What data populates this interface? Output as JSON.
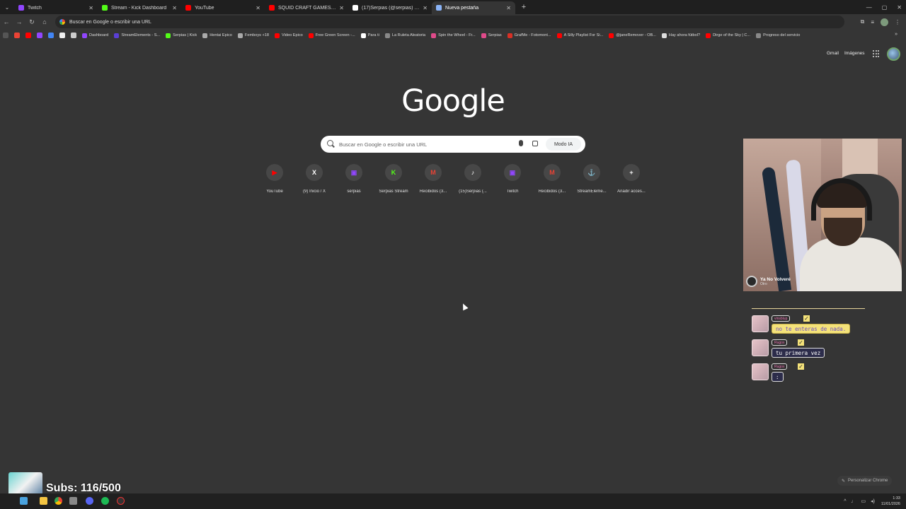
{
  "tabs": [
    {
      "title": "Twitch",
      "color": "#9146ff",
      "active": false
    },
    {
      "title": "Stream - Kick Dashboard",
      "color": "#53fc18",
      "active": false
    },
    {
      "title": "YouTube",
      "color": "#ff0000",
      "active": false
    },
    {
      "title": "SQUID CRAFT GAMES 4: POV D",
      "color": "#ff0000",
      "active": false
    },
    {
      "title": "(17)Serpias (@serpias) | TikTok",
      "color": "#ffffff",
      "active": false
    },
    {
      "title": "Nueva pestaña",
      "color": "#8ab4f8",
      "active": true
    }
  ],
  "omnibox": {
    "text": "Buscar en Google o escribir una URL"
  },
  "bookmarks": [
    {
      "label": "Dashboard",
      "color": "#9146ff"
    },
    {
      "label": "StreamElements - S...",
      "color": "#5a3fd6"
    },
    {
      "label": "Serpias | Kick",
      "color": "#53fc18"
    },
    {
      "label": "Hentai Epico",
      "color": "#aaaaaa"
    },
    {
      "label": "Femboys +18",
      "color": "#aaaaaa"
    },
    {
      "label": "Video Epico",
      "color": "#ff0000"
    },
    {
      "label": "Free Green Screen -...",
      "color": "#ff0000"
    },
    {
      "label": "Para ti",
      "color": "#ffffff"
    },
    {
      "label": "La Ruleta Aleatoria",
      "color": "#888888"
    },
    {
      "label": "Spin the Wheel - Fr...",
      "color": "#e04a8a"
    },
    {
      "label": "Serpias",
      "color": "#e04a8a"
    },
    {
      "label": "GrafMe - Fotomont...",
      "color": "#d93025"
    },
    {
      "label": "A Silly Playlist For Si...",
      "color": "#ff0000"
    },
    {
      "label": "@janeRemover - OB...",
      "color": "#ff0000"
    },
    {
      "label": "Hay ahora fútbol?",
      "color": "#dddddd"
    },
    {
      "label": "Dirge of the Sky | C...",
      "color": "#ff0000"
    },
    {
      "label": "Progreso del servicio",
      "color": "#888888"
    }
  ],
  "header": {
    "gmail": "Gmail",
    "images": "Imágenes"
  },
  "logo": "Google",
  "search": {
    "placeholder": "Buscar en Google o escribir una URL",
    "ai_mode": "Modo IA"
  },
  "shortcuts": [
    {
      "label": "YouTube",
      "glyph": "▶",
      "color": "#ff0000"
    },
    {
      "label": "(9) Inicio / X",
      "glyph": "X",
      "color": "#ffffff"
    },
    {
      "label": "serpias",
      "glyph": "▣",
      "color": "#9146ff"
    },
    {
      "label": "Serpias Stream",
      "glyph": "K",
      "color": "#53fc18"
    },
    {
      "label": "Recibidos (3...",
      "glyph": "M",
      "color": "#ea4335"
    },
    {
      "label": "(15)Serpias (...",
      "glyph": "♪",
      "color": "#ffffff"
    },
    {
      "label": "Twitch",
      "glyph": "▣",
      "color": "#9146ff"
    },
    {
      "label": "Recibidos (3...",
      "glyph": "M",
      "color": "#ea4335"
    },
    {
      "label": "StreamEleme...",
      "glyph": "⚓",
      "color": "#6a5cff"
    },
    {
      "label": "Añadir acces...",
      "glyph": "+",
      "color": "#ffffff"
    }
  ],
  "webcam": {
    "song_title": "Ya No Volveré",
    "song_artist": "Otro"
  },
  "chat": [
    {
      "name": "vinsblup",
      "message": "no te enteras de nada.",
      "bubble_color": "#f4e27a",
      "text_color": "#6b4cc4"
    },
    {
      "name": "Rugox",
      "message": "tu primera vez",
      "bubble_color": "#2c2c4a",
      "text_color": "#ffffff"
    },
    {
      "name": "Rugox",
      "message": ":",
      "bubble_color": "#2c2c4a",
      "text_color": "#ffffff"
    }
  ],
  "personalize": "Personalizar Chrome",
  "subs": "Subs: 116/500",
  "clock": {
    "time": "1:33",
    "date": "11/01/2026"
  }
}
